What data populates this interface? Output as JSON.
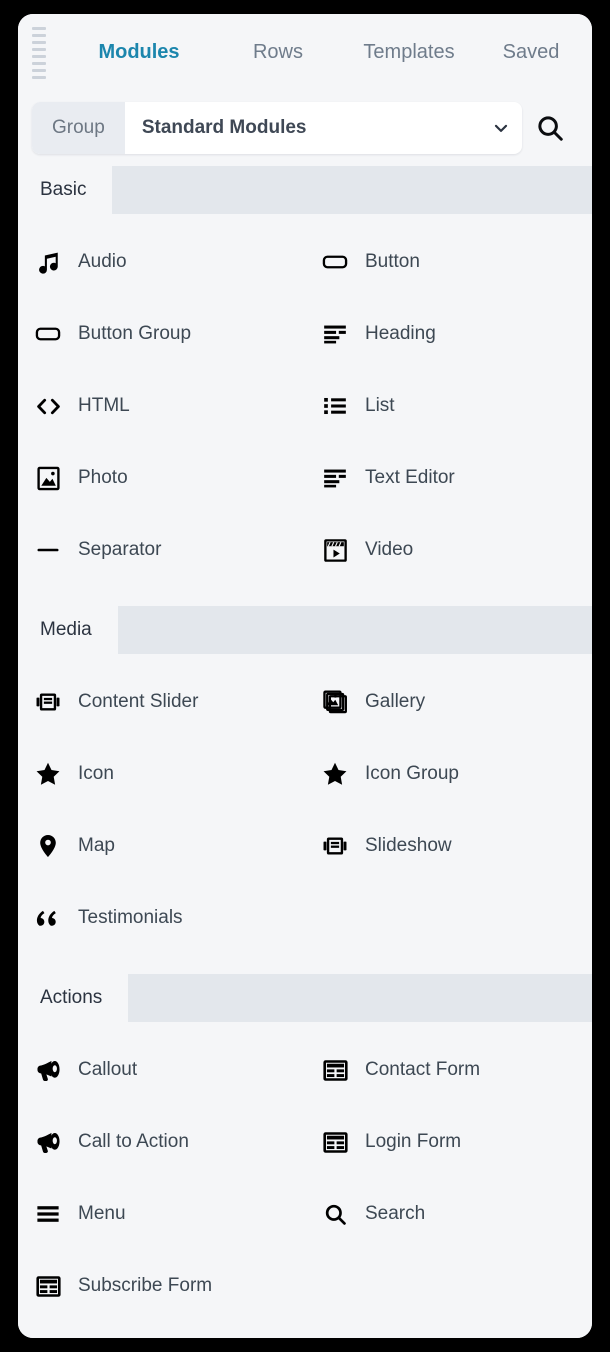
{
  "panel": {
    "drag_handle_icon": "drag-handle-icon",
    "background": "#f5f6f8"
  },
  "tabs": [
    {
      "label": "Modules",
      "active": true,
      "name": "tab-modules"
    },
    {
      "label": "Rows",
      "active": false,
      "name": "tab-rows"
    },
    {
      "label": "Templates",
      "active": false,
      "name": "tab-templates"
    },
    {
      "label": "Saved",
      "active": false,
      "name": "tab-saved"
    }
  ],
  "active_tab_color": "#1c86ad",
  "toolbar": {
    "group_label": "Group",
    "selected_group": "Standard Modules",
    "chevron_icon": "chevron-down-icon",
    "search_icon": "search-icon"
  },
  "sections": [
    {
      "title": "Basic",
      "items": [
        {
          "label": "Audio",
          "icon": "music-note-icon"
        },
        {
          "label": "Button",
          "icon": "button-rect-icon"
        },
        {
          "label": "Button Group",
          "icon": "button-rect-icon"
        },
        {
          "label": "Heading",
          "icon": "heading-lines-icon"
        },
        {
          "label": "HTML",
          "icon": "code-brackets-icon"
        },
        {
          "label": "List",
          "icon": "bullet-list-icon"
        },
        {
          "label": "Photo",
          "icon": "photo-icon"
        },
        {
          "label": "Text Editor",
          "icon": "text-lines-icon"
        },
        {
          "label": "Separator",
          "icon": "horizontal-rule-icon"
        },
        {
          "label": "Video",
          "icon": "video-clapperboard-icon"
        }
      ]
    },
    {
      "title": "Media",
      "items": [
        {
          "label": "Content Slider",
          "icon": "carousel-icon"
        },
        {
          "label": "Gallery",
          "icon": "gallery-stack-icon"
        },
        {
          "label": "Icon",
          "icon": "star-icon"
        },
        {
          "label": "Icon Group",
          "icon": "star-icon"
        },
        {
          "label": "Map",
          "icon": "map-pin-icon"
        },
        {
          "label": "Slideshow",
          "icon": "carousel-icon"
        },
        {
          "label": "Testimonials",
          "icon": "quote-marks-icon"
        }
      ]
    },
    {
      "title": "Actions",
      "items": [
        {
          "label": "Callout",
          "icon": "megaphone-icon"
        },
        {
          "label": "Contact Form",
          "icon": "form-table-icon"
        },
        {
          "label": "Call to Action",
          "icon": "megaphone-icon"
        },
        {
          "label": "Login Form",
          "icon": "form-table-icon"
        },
        {
          "label": "Menu",
          "icon": "hamburger-menu-icon"
        },
        {
          "label": "Search",
          "icon": "search-icon"
        },
        {
          "label": "Subscribe Form",
          "icon": "form-table-icon"
        }
      ]
    }
  ]
}
